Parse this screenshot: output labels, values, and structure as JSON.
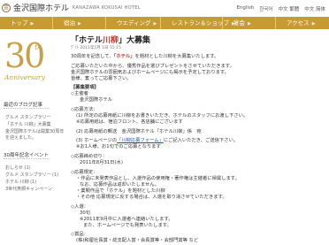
{
  "header": {
    "logo_mark": "金",
    "logo_jp": "金沢国際ホテル",
    "logo_en": "KANAZAWA KOKUSAI HOTEL",
    "langs": [
      "English",
      "한국어",
      "中文 繁體",
      "中文 简体"
    ]
  },
  "nav": [
    {
      "label": "トップ",
      "arrow": "▶"
    },
    {
      "label": "宿泊",
      "arrow": "▶"
    },
    {
      "label": "ウエディング",
      "arrow": "▶"
    },
    {
      "label": "レストラン＆ショップ",
      "arrow": "▶"
    },
    {
      "label": "宴会",
      "arrow": "▶"
    },
    {
      "label": "アクセス",
      "arrow": "▶"
    }
  ],
  "sidebar": {
    "anniv_num": "30",
    "anniv_th": "th",
    "anniv_word": "Anniversary",
    "recent_heading": "最近のブログ記事",
    "recent_links": [
      "グルメ スタンプラリー",
      "「ホテル 川柳」大募集",
      "金沢国際ホテルは開業30周年",
      "を迎えました。"
    ],
    "event_heading": "30周年記念イベント",
    "event_links": [
      "おしらせ (1)",
      "グルメ スタンプラリー (1)",
      "ホテル 川柳 (1)",
      "3世代笑顔キャンペーン"
    ]
  },
  "main": {
    "title_pre": "「ホテル",
    "title_accent": "川柳",
    "title_post": "」大募集",
    "date": "ﾃﾞｲﾄ 2011年5月 1日 15:15",
    "intro1": "30周年を記念して、",
    "intro1_bold": "「ホテル」",
    "intro1_post": "を題材とした川柳を大募集いたします。",
    "intro2": "ご応募いただいた中から、優秀作品を選びプレゼントをさせていただきます。",
    "intro3": "金沢国際ホテルの雰囲気およびホームページにも掲示を予定しております。",
    "intro4": "皆様、奮ってご応募下さい。",
    "sec_title": "【募集要項】",
    "sec1": "◇主催者",
    "sec1_val": "金沢国際ホテル",
    "sec2": "◇応募方法：",
    "sec2_a": "(1) 所定の応募用紙に川柳をお書きいただき、ホテルのスタッフにお渡し下さい。",
    "sec2_b": "※応募用紙は、宿泊フロント、各店舗にございます",
    "sec2_c": "(2) 応募用紙の郵送　金沢国際ホテル「ホテル川柳」係　宛",
    "sec2_d_pre": "(3) ホームページの",
    "sec2_d_link": "「川柳応募フォーム」",
    "sec2_d_post": "にご記入いただき、ご送信下さい。",
    "sec2_e": "※お1人様、お1句でのご応募となります",
    "sec3": "◇応募締め切り：",
    "sec3_val": "2011年8月31日(水)",
    "sec4": "◇応募規定：",
    "sec4_a": "・作品に未発表作品とし、入選作品の使用権・著作権は主催者に帰属します。",
    "sec4_b": "なお、応募作品は返却いたしません。",
    "sec4_c": "・業類作品で「ホテル」を題材とした川柳",
    "sec4_d": "・その他 応募規定に反する場合は、入選を取り消させていただきます。",
    "sec5": "◇入選：",
    "sec5_a": "30句",
    "sec5_b": "※2011年9月中に入選者へ連絡いたします。",
    "sec5_c": "また、ホームページでも発表いたします。",
    "sec6": "◇賞品：",
    "sec6_a": "(株)和屋社長賞・総支配人賞・会長賞等・会部門賞等 など"
  }
}
